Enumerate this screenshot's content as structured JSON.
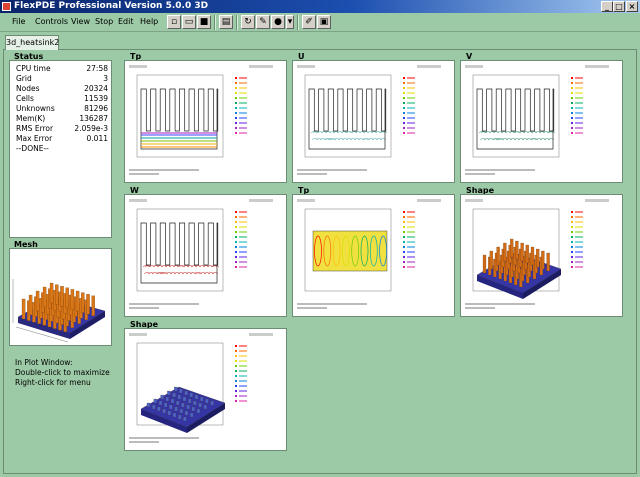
{
  "window": {
    "title": "FlexPDE Professional Version 5.0.0 3D",
    "min": "_",
    "max": "□",
    "close": "×"
  },
  "menu": [
    "File",
    "Controls",
    "View",
    "Stop",
    "Edit",
    "Help"
  ],
  "tab": "3d_heatsink2",
  "status": {
    "title": "Status",
    "rows": [
      {
        "label": "CPU time",
        "value": "27:58"
      },
      {
        "label": "Grid",
        "value": "3"
      },
      {
        "label": "Nodes",
        "value": "20324"
      },
      {
        "label": "Cells",
        "value": "11539"
      },
      {
        "label": "Unknowns",
        "value": "81296"
      },
      {
        "label": "Mem(K)",
        "value": "136287"
      },
      {
        "label": "RMS Error",
        "value": "2.059e-3"
      },
      {
        "label": "Max Error",
        "value": "0.011"
      }
    ],
    "done": "--DONE--"
  },
  "mesh": {
    "title": "Mesh"
  },
  "hint": [
    "In Plot Window:",
    "Double-click to maximize",
    "Right-click for menu"
  ],
  "plots": [
    {
      "title": "Tp",
      "kind": "contour"
    },
    {
      "title": "U",
      "kind": "vector"
    },
    {
      "title": "V",
      "kind": "vector"
    },
    {
      "title": "W",
      "kind": "vector"
    },
    {
      "title": "Tp",
      "kind": "contour-plan"
    },
    {
      "title": "Shape",
      "kind": "surface"
    },
    {
      "title": "Shape",
      "kind": "surface-flat"
    }
  ],
  "colors": {
    "background": "#9cc9a6",
    "orange": "#e07a1a",
    "blue": "#3030a0"
  }
}
